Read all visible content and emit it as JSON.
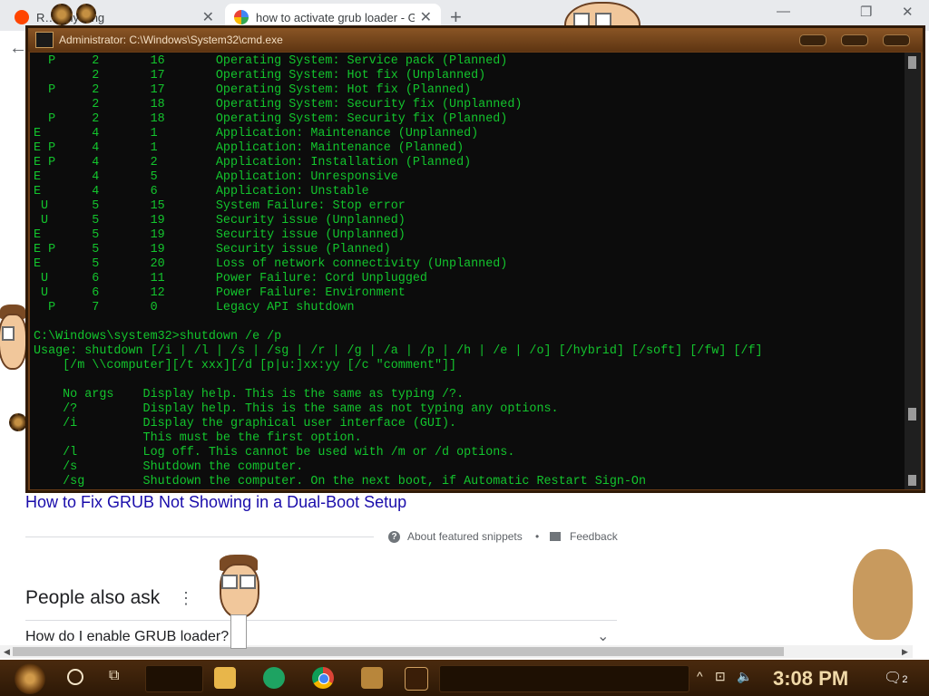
{
  "browser": {
    "tabs": [
      {
        "label": "R… anything",
        "active": false
      },
      {
        "label": "how to activate grub loader - G",
        "active": true
      }
    ],
    "new_tab_label": "+",
    "back_glyph": "←",
    "window_controls": {
      "minimize": "—",
      "restore": "❐",
      "close": "✕"
    },
    "tab_close_glyph": "✕"
  },
  "cmd_window": {
    "title": "Administrator: C:\\Windows\\System32\\cmd.exe",
    "console_lines": [
      "  P     2       16       Operating System: Service pack (Planned)",
      "        2       17       Operating System: Hot fix (Unplanned)",
      "  P     2       17       Operating System: Hot fix (Planned)",
      "        2       18       Operating System: Security fix (Unplanned)",
      "  P     2       18       Operating System: Security fix (Planned)",
      "E       4       1        Application: Maintenance (Unplanned)",
      "E P     4       1        Application: Maintenance (Planned)",
      "E P     4       2        Application: Installation (Planned)",
      "E       4       5        Application: Unresponsive",
      "E       4       6        Application: Unstable",
      " U      5       15       System Failure: Stop error",
      " U      5       19       Security issue (Unplanned)",
      "E       5       19       Security issue (Unplanned)",
      "E P     5       19       Security issue (Planned)",
      "E       5       20       Loss of network connectivity (Unplanned)",
      " U      6       11       Power Failure: Cord Unplugged",
      " U      6       12       Power Failure: Environment",
      "  P     7       0        Legacy API shutdown",
      "",
      "C:\\Windows\\system32>shutdown /e /p",
      "Usage: shutdown [/i | /l | /s | /sg | /r | /g | /a | /p | /h | /e | /o] [/hybrid] [/soft] [/fw] [/f]",
      "    [/m \\\\computer][/t xxx][/d [p|u:]xx:yy [/c \"comment\"]]",
      "",
      "    No args    Display help. This is the same as typing /?.",
      "    /?         Display help. This is the same as not typing any options.",
      "    /i         Display the graphical user interface (GUI).",
      "               This must be the first option.",
      "    /l         Log off. This cannot be used with /m or /d options.",
      "    /s         Shutdown the computer.",
      "    /sg        Shutdown the computer. On the next boot, if Automatic Restart Sign-On"
    ]
  },
  "page": {
    "result_link": "How to Fix GRUB Not Showing in a Dual-Boot Setup",
    "about_snippets": "About featured snippets",
    "bullet": "•",
    "feedback": "Feedback",
    "info_glyph": "?",
    "people_also_ask": "People also ask",
    "kebab_glyph": "⋮",
    "question_1": "How do I enable GRUB loader?",
    "chevron_glyph": "⌄"
  },
  "taskbar": {
    "clock": "3:08 PM",
    "notification_count": "2",
    "view_glyph": "⧉",
    "tray_glyphs": {
      "chevron": "^",
      "network": "⊡",
      "volume": "🔈"
    }
  },
  "icons": [
    "back-arrow-icon",
    "tab-close-icon",
    "new-tab-icon",
    "minimize-icon",
    "restore-icon",
    "close-icon",
    "info-icon",
    "feedback-icon",
    "kebab-icon",
    "chevron-down-icon",
    "start-icon",
    "cortana-icon",
    "task-view-icon",
    "file-explorer-icon",
    "sheets-icon",
    "chrome-icon",
    "network-icon",
    "volume-muted-icon",
    "notification-icon"
  ],
  "colors": {
    "console_text": "#13c52d",
    "console_bg": "#0c0c0c",
    "link": "#1a0dab",
    "theme_brown": "#6b3d17"
  }
}
